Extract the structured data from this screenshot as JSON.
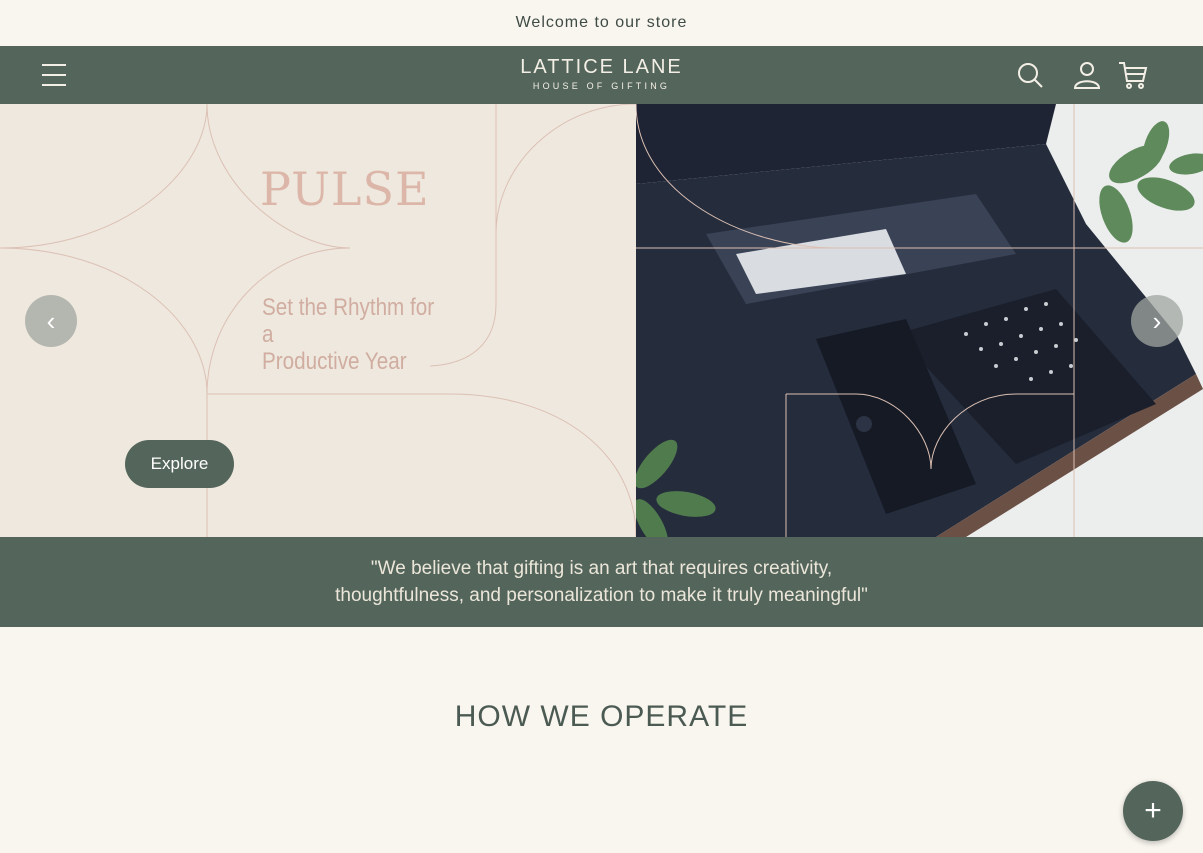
{
  "announcement": {
    "text": "Welcome to our store"
  },
  "header": {
    "logo_name": "LATTICE LANE",
    "logo_tagline": "HOUSE OF GIFTING",
    "icons": [
      "menu-icon",
      "search-icon",
      "account-icon",
      "cart-icon"
    ]
  },
  "hero": {
    "title": "PULSE",
    "subtitle_line1": "Set the Rhythm for a",
    "subtitle_line2": "Productive Year",
    "cta_label": "Explore",
    "prev_label": "‹",
    "next_label": "›"
  },
  "quote": {
    "line1": "\"We believe that gifting is an art that requires creativity,",
    "line2": "thoughtfulness, and personalization to make it truly meaningful\""
  },
  "section": {
    "title": "HOW WE OPERATE"
  },
  "fab": {
    "label": "+"
  },
  "colors": {
    "background": "#f9f6ef",
    "brand_green": "#54665b",
    "hero_cream": "#efe8de",
    "pulse_pink": "#dcb6a8"
  }
}
